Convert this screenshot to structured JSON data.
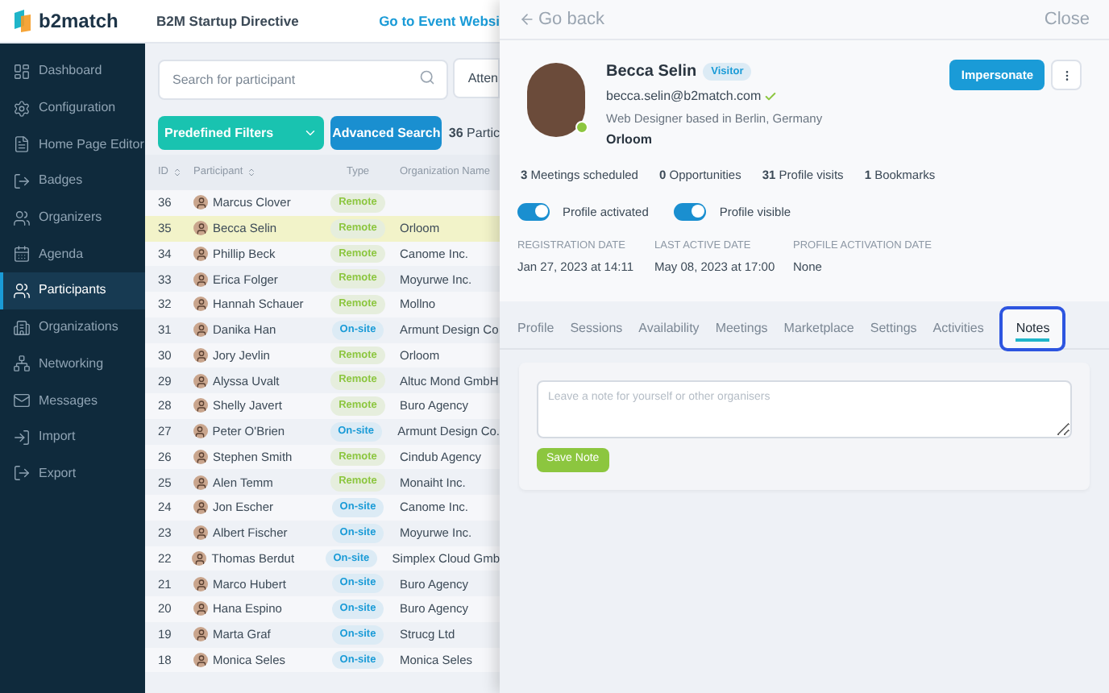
{
  "header": {
    "logo_text": "b2match",
    "event_title": "B2M Startup Directive",
    "website_link": "Go to Event Websi"
  },
  "sidebar": {
    "items": [
      {
        "label": "Dashboard",
        "selected": false
      },
      {
        "label": "Configuration",
        "selected": false
      },
      {
        "label": "Home Page Editor",
        "selected": false
      },
      {
        "label": "Badges",
        "selected": false
      },
      {
        "label": "Organizers",
        "selected": false
      },
      {
        "label": "Agenda",
        "selected": false
      },
      {
        "label": "Participants",
        "selected": true
      },
      {
        "label": "Organizations",
        "selected": false
      },
      {
        "label": "Networking",
        "selected": false
      },
      {
        "label": "Messages",
        "selected": false
      },
      {
        "label": "Import",
        "selected": false
      },
      {
        "label": "Export",
        "selected": false
      }
    ]
  },
  "search": {
    "placeholder": "Search for participant",
    "attendee_filter": "Atten"
  },
  "filters": {
    "predefined": "Predefined Filters",
    "advanced": "Advanced Search",
    "count": "**36** Partic"
  },
  "table": {
    "columns": [
      {
        "label": "ID",
        "sortable": true
      },
      {
        "label": "Participant",
        "sortable": true
      },
      {
        "label": "Type",
        "sortable": false
      },
      {
        "label": "Organization Name",
        "sortable": false
      }
    ],
    "rows": [
      {
        "id": "36",
        "name": "Marcus Clover",
        "type": {
          "kind": "remote",
          "label": "Remote"
        },
        "organization": "",
        "selected": false
      },
      {
        "id": "35",
        "name": "Becca Selin",
        "type": {
          "kind": "remote",
          "label": "Remote"
        },
        "organization": "Orloom",
        "selected": true
      },
      {
        "id": "34",
        "name": "Phillip Beck",
        "type": {
          "kind": "remote",
          "label": "Remote"
        },
        "organization": "Canome Inc.",
        "selected": false
      },
      {
        "id": "33",
        "name": "Erica Folger",
        "type": {
          "kind": "remote",
          "label": "Remote"
        },
        "organization": "Moyurwe Inc.",
        "selected": false
      },
      {
        "id": "32",
        "name": "Hannah Schauer",
        "type": {
          "kind": "remote",
          "label": "Remote"
        },
        "organization": "Mollno",
        "selected": false
      },
      {
        "id": "31",
        "name": "Danika Han",
        "type": {
          "kind": "onsite",
          "label": "On-site"
        },
        "organization": "Armunt Design Co",
        "selected": false
      },
      {
        "id": "30",
        "name": "Jory Jevlin",
        "type": {
          "kind": "remote",
          "label": "Remote"
        },
        "organization": "Orloom",
        "selected": false
      },
      {
        "id": "29",
        "name": "Alyssa Uvalt",
        "type": {
          "kind": "remote",
          "label": "Remote"
        },
        "organization": "Altuc Mond GmbH",
        "selected": false
      },
      {
        "id": "28",
        "name": "Shelly Javert",
        "type": {
          "kind": "remote",
          "label": "Remote"
        },
        "organization": "Buro Agency",
        "selected": false
      },
      {
        "id": "27",
        "name": "Peter O'Brien",
        "type": {
          "kind": "onsite",
          "label": "On-site"
        },
        "organization": "Armunt Design Co.",
        "selected": false
      },
      {
        "id": "26",
        "name": "Stephen Smith",
        "type": {
          "kind": "remote",
          "label": "Remote"
        },
        "organization": "Cindub Agency",
        "selected": false
      },
      {
        "id": "25",
        "name": "Alen Temm",
        "type": {
          "kind": "remote",
          "label": "Remote"
        },
        "organization": "Monaiht Inc.",
        "selected": false
      },
      {
        "id": "24",
        "name": "Jon Escher",
        "type": {
          "kind": "onsite",
          "label": "On-site"
        },
        "organization": "Canome Inc.",
        "selected": false
      },
      {
        "id": "23",
        "name": "Albert Fischer",
        "type": {
          "kind": "onsite",
          "label": "On-site"
        },
        "organization": "Moyurwe Inc.",
        "selected": false
      },
      {
        "id": "22",
        "name": "Thomas Berdut",
        "type": {
          "kind": "onsite",
          "label": "On-site"
        },
        "organization": "Simplex Cloud Gmb",
        "selected": false
      },
      {
        "id": "21",
        "name": "Marco Hubert",
        "type": {
          "kind": "onsite",
          "label": "On-site"
        },
        "organization": "Buro Agency",
        "selected": false
      },
      {
        "id": "20",
        "name": "Hana Espino",
        "type": {
          "kind": "onsite",
          "label": "On-site"
        },
        "organization": "Buro Agency",
        "selected": false
      },
      {
        "id": "19",
        "name": "Marta Graf",
        "type": {
          "kind": "onsite",
          "label": "On-site"
        },
        "organization": "Strucg Ltd",
        "selected": false
      },
      {
        "id": "18",
        "name": "Monica Seles",
        "type": {
          "kind": "onsite",
          "label": "On-site"
        },
        "organization": "Monica Seles",
        "selected": false
      }
    ]
  },
  "panel": {
    "go_back": "Go back",
    "close": "Close",
    "profile": {
      "name": "Becca Selin",
      "badge": "Visitor",
      "email": "becca.selin@b2match.com",
      "verified": true,
      "headline": "Web Designer based in Berlin, Germany",
      "organization": "Orloom",
      "online": true
    },
    "impersonate": "Impersonate",
    "stats": [
      {
        "count": "3",
        "label": "Meetings scheduled"
      },
      {
        "count": "0",
        "label": "Opportunities"
      },
      {
        "count": "31",
        "label": "Profile visits"
      },
      {
        "count": "1",
        "label": "Bookmarks"
      }
    ],
    "toggles": [
      {
        "label": "Profile activated",
        "on": true
      },
      {
        "label": "Profile visible",
        "on": true
      }
    ],
    "dates": [
      {
        "label": "REGISTRATION DATE",
        "value": "Jan 27, 2023 at 14:11"
      },
      {
        "label": "LAST ACTIVE DATE",
        "value": "May 08, 2023 at 17:00"
      },
      {
        "label": "PROFILE ACTIVATION DATE",
        "value": "None"
      }
    ],
    "tabs": [
      {
        "label": "Profile",
        "selected": false
      },
      {
        "label": "Sessions",
        "selected": false
      },
      {
        "label": "Availability",
        "selected": false
      },
      {
        "label": "Meetings",
        "selected": false
      },
      {
        "label": "Marketplace",
        "selected": false
      },
      {
        "label": "Settings",
        "selected": false
      },
      {
        "label": "Activities",
        "selected": false
      },
      {
        "label": "Notes",
        "selected": true
      }
    ],
    "note": {
      "placeholder": "Leave a note for yourself or other organisers",
      "save_label": "Save Note"
    }
  }
}
